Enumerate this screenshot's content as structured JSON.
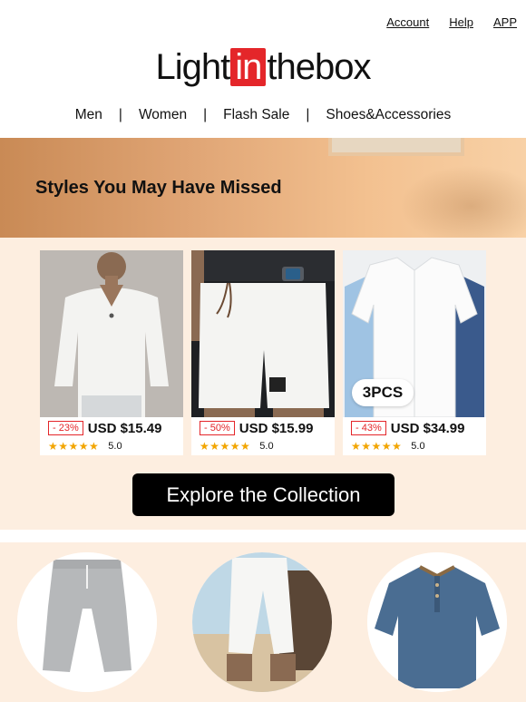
{
  "top_links": [
    "Account",
    "Help",
    "APP"
  ],
  "logo": {
    "left": "Light",
    "box": "in",
    "right": "thebox"
  },
  "nav": [
    "Men",
    "Women",
    "Flash Sale",
    "Shoes&Accessories"
  ],
  "nav_separator": "|",
  "hero": {
    "title": "Styles You May Have Missed"
  },
  "products": [
    {
      "discount": "- 23%",
      "price": "USD $15.49",
      "stars": "★★★★★",
      "rating": "5.0",
      "image": "white-v-neck-long-sleeve-tee"
    },
    {
      "discount": "- 50%",
      "price": "USD $15.99",
      "stars": "★★★★★",
      "rating": "5.0",
      "image": "white-drawstring-shorts"
    },
    {
      "discount": "- 43%",
      "price": "USD $34.99",
      "stars": "★★★★★",
      "rating": "5.0",
      "image": "linen-short-sleeve-shirts",
      "tag": "3PCS"
    }
  ],
  "cta": {
    "label": "Explore the Collection"
  },
  "categories": [
    {
      "image": "grey-knee-length-pants"
    },
    {
      "image": "white-cropped-beach-pants"
    },
    {
      "image": "blue-henley-tee"
    }
  ],
  "colors": {
    "accent": "#e4262a",
    "star": "#f2a500",
    "panel": "#fdeee0",
    "cta": "#000000"
  }
}
